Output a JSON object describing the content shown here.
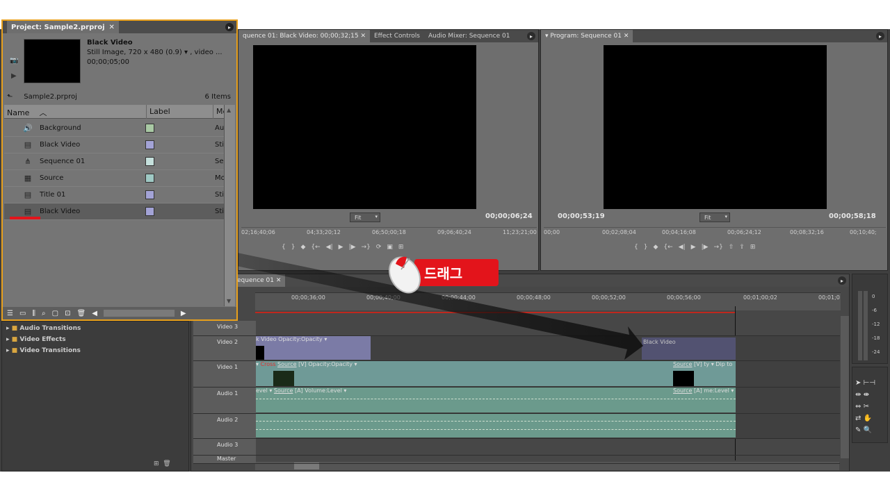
{
  "project": {
    "tab_title": "Project: Sample2.prproj",
    "selected_name": "Black Video",
    "selected_type": "Still Image, 720 x 480 (0.9)",
    "selected_type_more": ", video ...",
    "selected_duration": "00;00;05;00",
    "folder_name": "Sample2.prproj",
    "item_count": "6 Items",
    "columns": {
      "name": "Name",
      "label": "Label",
      "media": "Me"
    },
    "items": [
      {
        "name": "Background",
        "media": "Aud",
        "icon": "audio-icon",
        "label_color": "#a9c9a4"
      },
      {
        "name": "Black Video",
        "media": "Stil",
        "icon": "still-image-icon",
        "label_color": "#a3a3d6"
      },
      {
        "name": "Sequence 01",
        "media": "Seq",
        "icon": "sequence-icon",
        "label_color": "#c5e0dc"
      },
      {
        "name": "Source",
        "media": "Mo",
        "icon": "movie-icon",
        "label_color": "#9fc9c4"
      },
      {
        "name": "Title 01",
        "media": "Stil",
        "icon": "still-image-icon",
        "label_color": "#a3a3d6"
      },
      {
        "name": "Black Video",
        "media": "Stil",
        "icon": "still-image-icon",
        "label_color": "#a3a3d6"
      }
    ]
  },
  "source_monitor": {
    "tabs": [
      "quence 01: Black Video: 00;00;32;15",
      "Effect Controls",
      "Audio Mixer: Sequence 01"
    ],
    "fit_label": "Fit",
    "timecode_right": "00;00;06;24",
    "ruler": [
      "02;16;40;06",
      "04;33;20;12",
      "06;50;00;18",
      "09;06;40;24",
      "11;23;21;00"
    ]
  },
  "program_monitor": {
    "tab": "Program: Sequence 01",
    "fit_label": "Fit",
    "timecode_left": "00;00;53;19",
    "timecode_right": "00;00;58;18",
    "ruler": [
      "00;00",
      "00;02;08;04",
      "00;04;16;08",
      "00;06;24;12",
      "00;08;32;16",
      "00;10;40;"
    ]
  },
  "timeline": {
    "tab": "equence 01",
    "ruler": [
      "00;00;36;00",
      "00;00;40;00",
      "00;00;44;00",
      "00;00;48;00",
      "00;00;52;00",
      "00;00;56;00",
      "00;01;00;02",
      "00;01;0"
    ],
    "tracks": {
      "v3": "Video 3",
      "v2": "Video 2",
      "v1": "Video 1",
      "a1": "Audio 1",
      "a2": "Audio 2",
      "a3": "Audio 3",
      "master": "Master"
    },
    "clips": {
      "v2_clip": "k Video",
      "v2_opacity": "Opacity:Opacity",
      "drag_ghost": "Black Video",
      "v1_cross": "Cross",
      "v1_source": "Source",
      "v1_source_suffix": "[V]",
      "v1_opacity": "Opacity:Opacity",
      "v1_source_end": "Source",
      "v1_source_end_suffix": "[V]",
      "v1_ty": "ty",
      "v1_dip": "Dip to",
      "a1_level": "evel",
      "a1_source": "Source",
      "a1_source_suffix": "[A]",
      "a1_volume": "Volume:Level",
      "a1_source_end": "Source",
      "a1_source_end_suffix": "[A]",
      "a1_level_end": "me:Level"
    }
  },
  "effects": {
    "folders": [
      "Audio Transitions",
      "Video Effects",
      "Video Transitions"
    ]
  },
  "meter": {
    "labels": [
      "0",
      "-6",
      "-12",
      "-18",
      "-24"
    ]
  },
  "annotation": {
    "bubble_text": "드래그"
  },
  "colors": {
    "accent_border": "#e8a01c",
    "bubble_red": "#e3141b"
  }
}
